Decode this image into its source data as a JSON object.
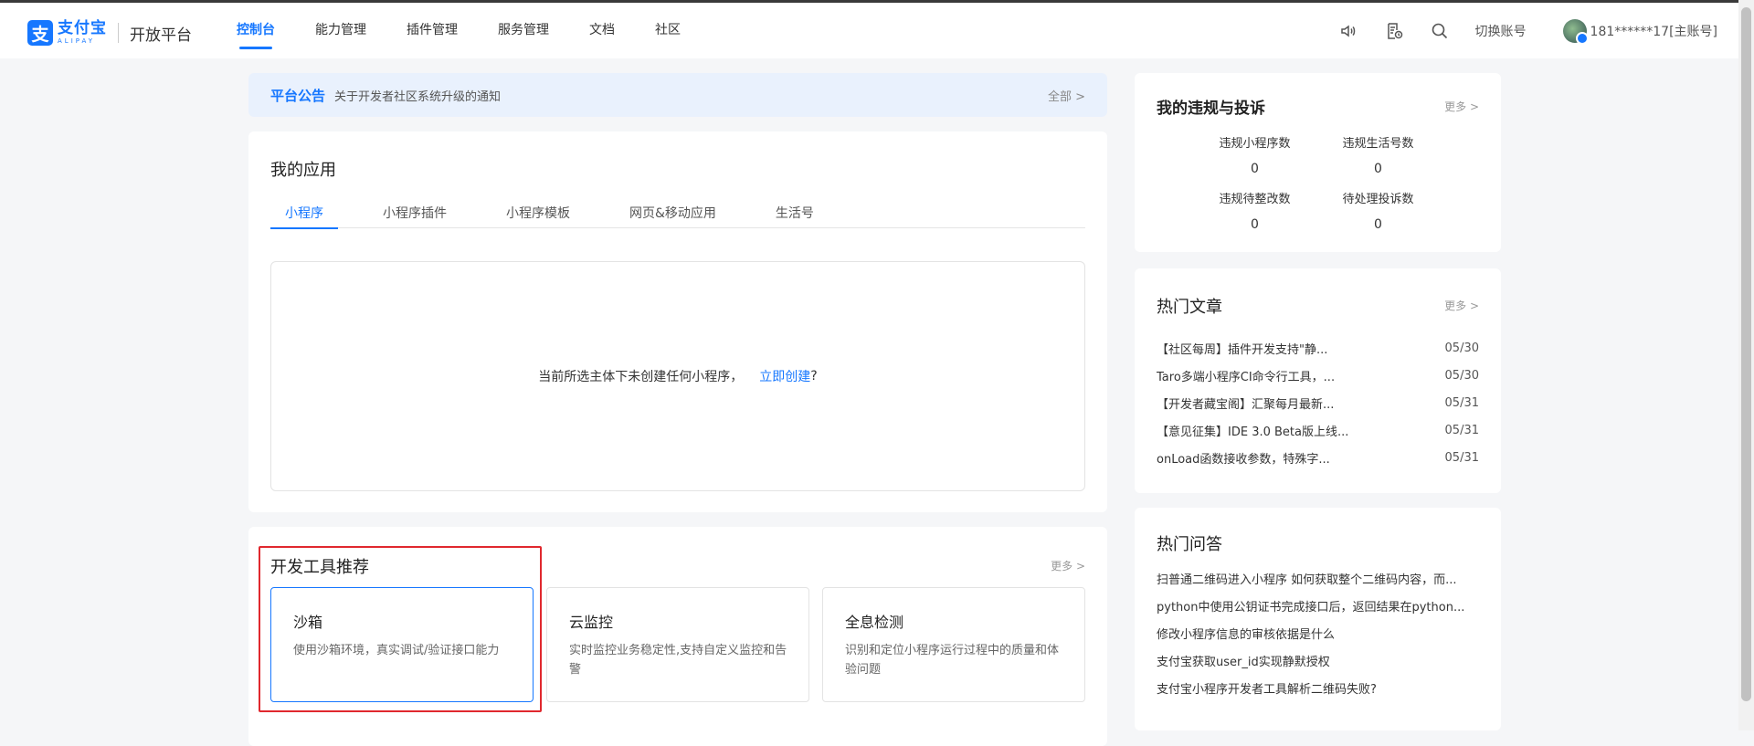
{
  "header": {
    "logo_cn": "支付宝",
    "logo_en": "ALIPAY",
    "logo_mark": "支",
    "platform": "开放平台",
    "nav": [
      {
        "label": "控制台",
        "active": true
      },
      {
        "label": "能力管理"
      },
      {
        "label": "插件管理"
      },
      {
        "label": "服务管理"
      },
      {
        "label": "文档"
      },
      {
        "label": "社区"
      }
    ],
    "icons": [
      "speaker-icon",
      "document-clock-icon",
      "search-icon"
    ],
    "switch_account": "切换账号",
    "account": "181******17[主账号]"
  },
  "announcement": {
    "tag": "平台公告",
    "text": "关于开发者社区系统升级的通知",
    "all": "全部 >"
  },
  "my_apps": {
    "title": "我的应用",
    "tabs": [
      "小程序",
      "小程序插件",
      "小程序模板",
      "网页&移动应用",
      "生活号"
    ],
    "active_tab": "小程序",
    "empty_text": "当前所选主体下未创建任何小程序，",
    "empty_link": "立即创建",
    "empty_suffix": "?"
  },
  "dev_tools": {
    "title": "开发工具推荐",
    "more": "更多 >",
    "tools": [
      {
        "name": "沙箱",
        "desc": "使用沙箱环境，真实调试/验证接口能力"
      },
      {
        "name": "云监控",
        "desc": "实时监控业务稳定性,支持自定义监控和告警"
      },
      {
        "name": "全息检测",
        "desc": "识别和定位小程序运行过程中的质量和体验问题"
      }
    ]
  },
  "violations": {
    "title": "我的违规与投诉",
    "more": "更多 >",
    "items": [
      {
        "label": "违规小程序数",
        "value": "0"
      },
      {
        "label": "违规生活号数",
        "value": "0"
      },
      {
        "label": "违规待整改数",
        "value": "0"
      },
      {
        "label": "待处理投诉数",
        "value": "0"
      }
    ]
  },
  "hot_articles": {
    "title": "热门文章",
    "more": "更多 >",
    "items": [
      {
        "text": "【社区每周】插件开发支持\"静...",
        "date": "05/30"
      },
      {
        "text": "Taro多端小程序CI命令行工具，...",
        "date": "05/30"
      },
      {
        "text": "【开发者藏宝阁】汇聚每月最新...",
        "date": "05/31"
      },
      {
        "text": "【意见征集】IDE 3.0 Beta版上线...",
        "date": "05/31"
      },
      {
        "text": "onLoad函数接收参数，特殊字...",
        "date": "05/31"
      }
    ]
  },
  "hot_qa": {
    "title": "热门问答",
    "items": [
      "扫普通二维码进入小程序 如何获取整个二维码内容，而...",
      "python中使用公钥证书完成接口后，返回结果在python...",
      "修改小程序信息的审核依据是什么",
      "支付宝获取user_id实现静默授权",
      "支付宝小程序开发者工具解析二维码失败?"
    ]
  }
}
